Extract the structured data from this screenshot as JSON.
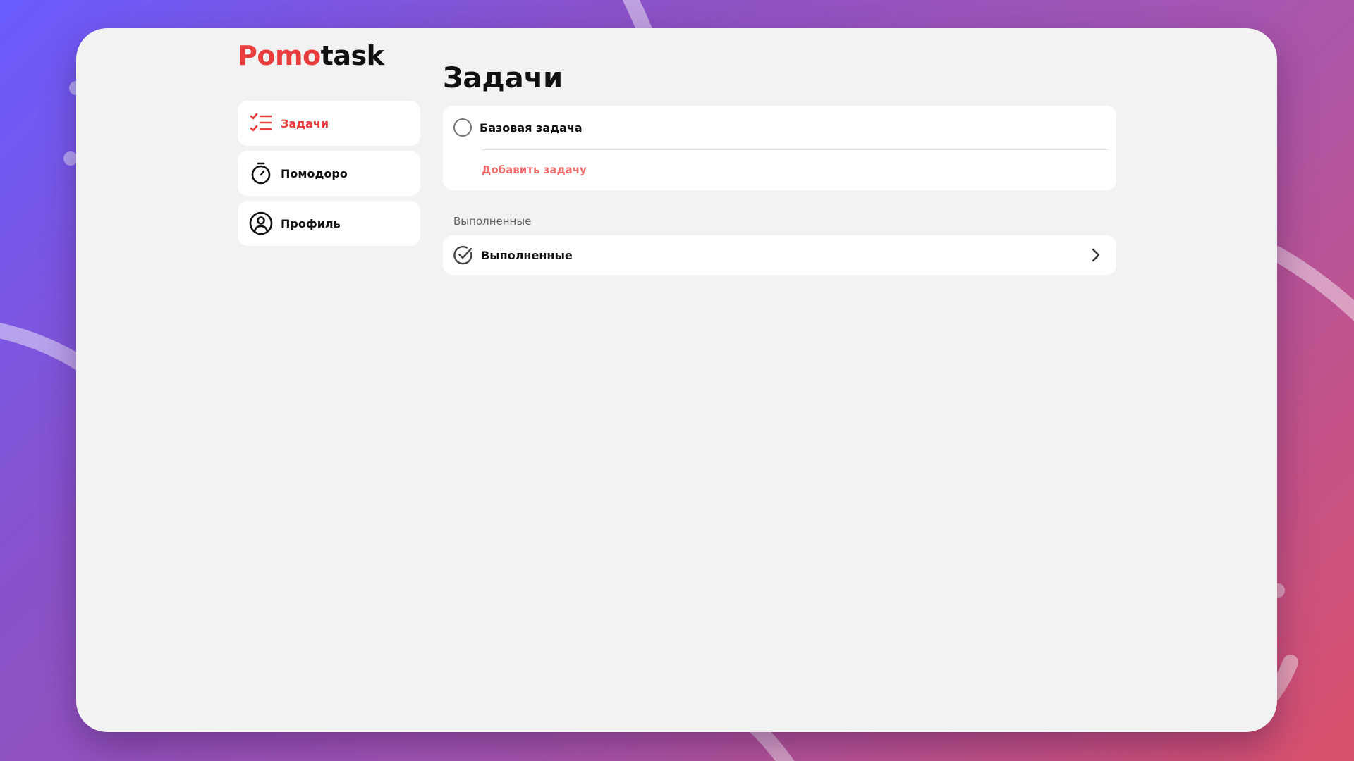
{
  "app": {
    "logo_part1": "Pomo",
    "logo_part2": "task",
    "accent_color": "#ea3d3d"
  },
  "sidebar": {
    "items": [
      {
        "label": "Задачи",
        "icon": "tasks-list-icon",
        "active": true
      },
      {
        "label": "Помодоро",
        "icon": "stopwatch-icon",
        "active": false
      },
      {
        "label": "Профиль",
        "icon": "user-circle-icon",
        "active": false
      }
    ]
  },
  "main": {
    "title": "Задачи",
    "tasks": [
      {
        "label": "Базовая задача",
        "done": false
      }
    ],
    "add_task_label": "Добавить задачу",
    "completed_section": {
      "header": "Выполненные",
      "row_label": "Выполненные",
      "icon": "check-circle-icon",
      "chevron_icon": "chevron-right-icon"
    }
  }
}
